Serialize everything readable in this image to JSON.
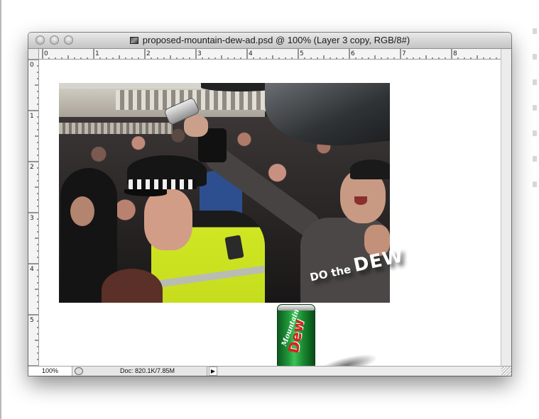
{
  "window": {
    "title": "proposed-mountain-dew-ad.psd @ 100% (Layer 3 copy, RGB/8#)",
    "document_icon": "psd-document-icon",
    "traffic_lights": [
      "close-button",
      "minimize-button",
      "zoom-button"
    ]
  },
  "rulers": {
    "top_labels": [
      "0",
      "1",
      "2",
      "3",
      "4",
      "5",
      "6",
      "7",
      "8"
    ],
    "left_labels": [
      "0",
      "1",
      "2",
      "3",
      "4",
      "5"
    ],
    "unit": "inches"
  },
  "canvas": {
    "dew_text_small": "DO the ",
    "dew_text_big": "DEW",
    "can_brand_top": "Mountain",
    "can_brand_bottom": "Dew",
    "can_colors": {
      "green": "#1f9a3a",
      "red": "#d9201f"
    }
  },
  "statusbar": {
    "zoom": "100%",
    "doc_info": "Doc: 820.1K/7.85M",
    "arrow_glyph": "▶"
  },
  "colors": {
    "hi_vis": "#cfe623",
    "window_chrome": "#e7e7e7"
  }
}
